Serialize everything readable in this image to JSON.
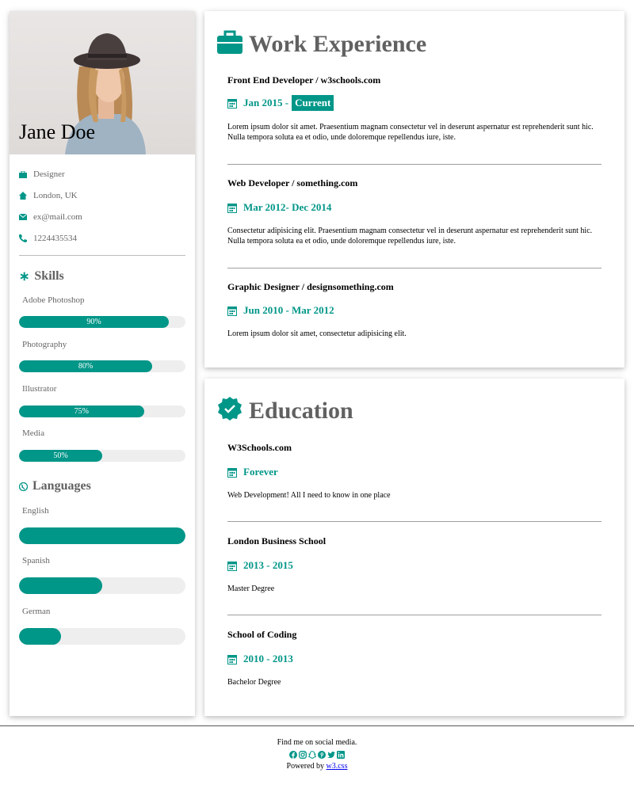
{
  "profile": {
    "name": "Jane Doe",
    "info": [
      {
        "icon": "briefcase-icon",
        "text": "Designer"
      },
      {
        "icon": "home-icon",
        "text": "London, UK"
      },
      {
        "icon": "envelope-icon",
        "text": "ex@mail.com"
      },
      {
        "icon": "phone-icon",
        "text": "1224435534"
      }
    ]
  },
  "skills": {
    "title": "Skills",
    "items": [
      {
        "label": "Adobe Photoshop",
        "value": 90,
        "text": "90%"
      },
      {
        "label": "Photography",
        "value": 80,
        "text": "80%"
      },
      {
        "label": "Illustrator",
        "value": 75,
        "text": "75%"
      },
      {
        "label": "Media",
        "value": 50,
        "text": "50%"
      }
    ]
  },
  "languages": {
    "title": "Languages",
    "items": [
      {
        "label": "English",
        "value": 100
      },
      {
        "label": "Spanish",
        "value": 50
      },
      {
        "label": "German",
        "value": 25
      }
    ]
  },
  "work": {
    "title": "Work Experience",
    "entries": [
      {
        "title": "Front End Developer / w3schools.com",
        "date": "Jan 2015 -",
        "tag": "Current",
        "text": "Lorem ipsum dolor sit amet. Praesentium magnam consectetur vel in deserunt aspernatur est reprehenderit sunt hic. Nulla tempora soluta ea et odio, unde doloremque repellendus iure, iste."
      },
      {
        "title": "Web Developer / something.com",
        "date": "Mar 2012- Dec 2014",
        "text": "Consectetur adipisicing elit. Praesentium magnam consectetur vel in deserunt aspernatur est reprehenderit sunt hic. Nulla tempora soluta ea et odio, unde doloremque repellendus iure, iste."
      },
      {
        "title": "Graphic Designer / designsomething.com",
        "date": "Jun 2010 - Mar 2012",
        "text": "Lorem ipsum dolor sit amet, consectetur adipisicing elit."
      }
    ]
  },
  "education": {
    "title": "Education",
    "entries": [
      {
        "title": "W3Schools.com",
        "date": "Forever",
        "text": "Web Development! All I need to know in one place"
      },
      {
        "title": "London Business School",
        "date": "2013 - 2015",
        "text": "Master Degree"
      },
      {
        "title": "School of Coding",
        "date": "2010 - 2013",
        "text": "Bachelor Degree"
      }
    ]
  },
  "footer": {
    "find_text": "Find me on social media.",
    "socials": [
      "facebook-icon",
      "instagram-icon",
      "snapchat-icon",
      "pinterest-icon",
      "twitter-icon",
      "linkedin-icon"
    ],
    "powered_prefix": "Powered by ",
    "powered_link": "w3.css"
  },
  "colors": {
    "accent": "#009688",
    "heading": "#616161",
    "track": "#eeeeee"
  }
}
